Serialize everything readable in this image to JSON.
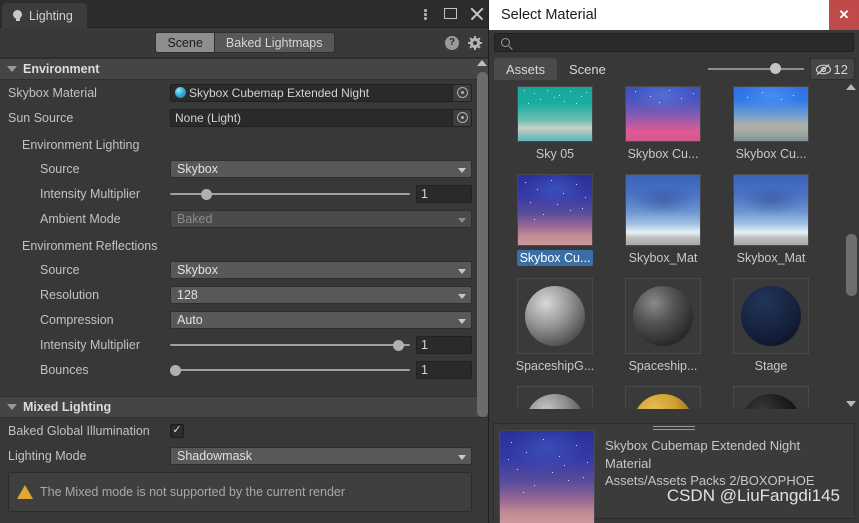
{
  "lighting_window": {
    "tab_label": "Lighting",
    "tab_icon": "light-bulb-icon",
    "window_controls": {
      "menu": "⋮",
      "maximize": "□",
      "close": "✕"
    },
    "toolbar": {
      "scene_tab": "Scene",
      "baked_lightmaps_tab": "Baked Lightmaps",
      "help_label": "?",
      "gear_icon": "gear-icon"
    },
    "sections": [
      {
        "title": "Environment",
        "expanded": true,
        "fields": [
          {
            "label": "Skybox Material",
            "type": "object",
            "value": "Skybox Cubemap Extended Night",
            "label_color": "#4c8ed6"
          },
          {
            "label": "Sun Source",
            "type": "object",
            "value": "None (Light)"
          }
        ],
        "groups": [
          {
            "title": "Environment Lighting",
            "fields": [
              {
                "label": "Source",
                "type": "dropdown",
                "value": "Skybox"
              },
              {
                "label": "Intensity Multiplier",
                "type": "slider",
                "value": "1",
                "fill": 15
              },
              {
                "label": "Ambient Mode",
                "type": "dropdown",
                "value": "Baked",
                "disabled": true
              }
            ]
          },
          {
            "title": "Environment Reflections",
            "fields": [
              {
                "label": "Source",
                "type": "dropdown",
                "value": "Skybox"
              },
              {
                "label": "Resolution",
                "type": "dropdown",
                "value": "128"
              },
              {
                "label": "Compression",
                "type": "dropdown",
                "value": "Auto"
              },
              {
                "label": "Intensity Multiplier",
                "type": "slider",
                "value": "1",
                "fill": 97
              },
              {
                "label": "Bounces",
                "type": "slider",
                "value": "1",
                "fill": 3
              }
            ]
          }
        ]
      },
      {
        "title": "Mixed Lighting",
        "expanded": true,
        "fields": [
          {
            "label": "Baked Global Illumination",
            "type": "checkbox",
            "checked": true
          },
          {
            "label": "Lighting Mode",
            "type": "dropdown",
            "value": "Shadowmask"
          }
        ],
        "warning": "The Mixed mode is not supported by the current render"
      }
    ]
  },
  "select_material": {
    "title": "Select Material",
    "close_label": "✕",
    "search": {
      "placeholder": "",
      "value": "",
      "icon": "search-icon"
    },
    "tabs": [
      {
        "label": "Assets",
        "active": true
      },
      {
        "label": "Scene",
        "active": false
      }
    ],
    "zoom_slider": {
      "value": 65
    },
    "visibility_badge": {
      "icon": "eye-crossed-icon",
      "count": "12"
    },
    "assets": [
      {
        "label": "Sky 05",
        "thumb": "sky-a",
        "selected": false
      },
      {
        "label": "Skybox Cu...",
        "thumb": "sky-b",
        "selected": false
      },
      {
        "label": "Skybox Cu...",
        "thumb": "sky-c",
        "selected": false
      },
      {
        "label": "Skybox Cu...",
        "thumb": "sky-d",
        "selected": true
      },
      {
        "label": "Skybox_Mat",
        "thumb": "sky-e",
        "selected": false
      },
      {
        "label": "Skybox_Mat",
        "thumb": "sky-e",
        "selected": false
      },
      {
        "label": "SpaceshipG...",
        "thumb": "sphere-gray",
        "selected": false
      },
      {
        "label": "Spaceship...",
        "thumb": "sphere-dark",
        "selected": false
      },
      {
        "label": "Stage",
        "thumb": "sphere-navy",
        "selected": false
      }
    ],
    "preview": {
      "name": "Skybox Cubemap Extended Night",
      "type": "Material",
      "path": "Assets/Assets Packs 2/BOXOPHOE",
      "thumb": "sky-d"
    },
    "watermark": "CSDN @LiuFangdi145"
  }
}
